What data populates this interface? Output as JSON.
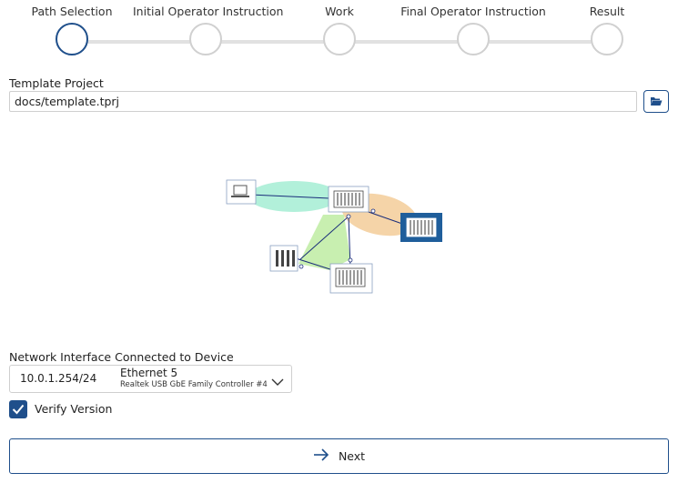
{
  "stepper": {
    "steps": [
      {
        "label": "Path Selection",
        "active": true
      },
      {
        "label": "Initial Operator Instruction",
        "active": false
      },
      {
        "label": "Work",
        "active": false
      },
      {
        "label": "Final Operator Instruction",
        "active": false
      },
      {
        "label": "Result",
        "active": false
      }
    ]
  },
  "template": {
    "label": "Template Project",
    "value": "docs/template.tprj",
    "browse_icon": "folder-open-icon"
  },
  "network": {
    "label": "Network Interface Connected to Device",
    "ip": "10.0.1.254/24",
    "adapter_name": "Ethernet 5",
    "adapter_desc": "Realtek USB GbE Family Controller #4"
  },
  "verify": {
    "label": "Verify Version",
    "checked": true
  },
  "next": {
    "label": "Next",
    "icon": "arrow-right-icon"
  },
  "colors": {
    "accent": "#1f4f8b",
    "teal_zone": "#b2f0da",
    "orange_zone": "#f5d4a8",
    "green_zone": "#c8efb0"
  }
}
